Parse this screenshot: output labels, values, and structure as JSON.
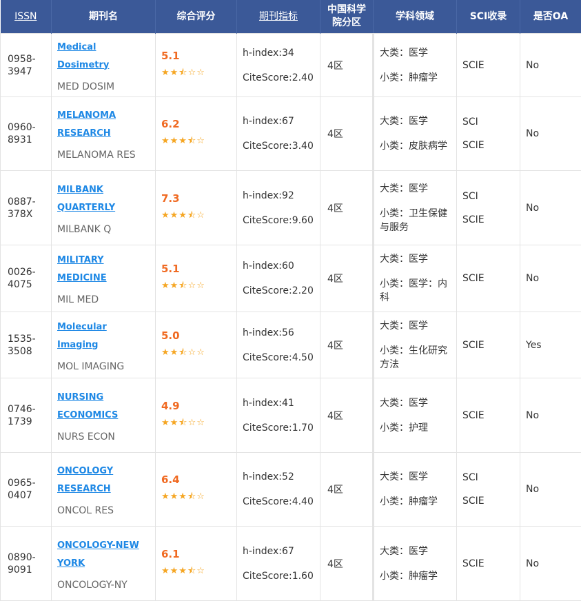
{
  "headers": {
    "issn": "ISSN",
    "name": "期刊名",
    "score": "综合评分",
    "metrics": "期刊指标",
    "zone_line1": "中国科学",
    "zone_line2": "院分区",
    "subject": "学科领域",
    "sci": "SCI收录",
    "oa": "是否OA"
  },
  "rows": [
    {
      "issn1": "0958-",
      "issn2": "3947",
      "name_lines": [
        "Medical Dosimetry",
        ""
      ],
      "abbr": "MED DOSIM",
      "score": "5.1",
      "stars": "★★⯪☆☆",
      "hindex": "h-index:34",
      "citescore": "CiteScore:2.40",
      "zone": "4区",
      "major": "大类：医学",
      "minor": "小类：肿瘤学",
      "sci": [
        "SCIE",
        ""
      ],
      "oa": "No"
    },
    {
      "issn1": "0960-",
      "issn2": "8931",
      "name_lines": [
        "MELANOMA",
        "RESEARCH"
      ],
      "abbr": "MELANOMA RES",
      "score": "6.2",
      "stars": "★★★⯪☆",
      "hindex": "h-index:67",
      "citescore": "CiteScore:3.40",
      "zone": "4区",
      "major": "大类：医学",
      "minor": "小类：皮肤病学",
      "sci": [
        "SCI",
        "SCIE"
      ],
      "oa": "No"
    },
    {
      "issn1": "0887-",
      "issn2": "378X",
      "name_lines": [
        "MILBANK",
        "QUARTERLY"
      ],
      "abbr": "MILBANK Q",
      "score": "7.3",
      "stars": "★★★⯪☆",
      "hindex": "h-index:92",
      "citescore": "CiteScore:9.60",
      "zone": "4区",
      "major": "大类：医学",
      "minor": "小类：卫生保健与服务",
      "sci": [
        "SCI",
        "SCIE"
      ],
      "oa": "No"
    },
    {
      "issn1": "0026-",
      "issn2": "4075",
      "name_lines": [
        "MILITARY MEDICINE",
        ""
      ],
      "abbr": "MIL MED",
      "score": "5.1",
      "stars": "★★⯪☆☆",
      "hindex": "h-index:60",
      "citescore": "CiteScore:2.20",
      "zone": "4区",
      "major": "大类：医学",
      "minor": "小类：医学：内科",
      "sci": [
        "SCIE",
        ""
      ],
      "oa": "No"
    },
    {
      "issn1": "1535-",
      "issn2": "3508",
      "name_lines": [
        "Molecular Imaging",
        ""
      ],
      "abbr": "MOL IMAGING",
      "score": "5.0",
      "stars": "★★⯪☆☆",
      "hindex": "h-index:56",
      "citescore": "CiteScore:4.50",
      "zone": "4区",
      "major": "大类：医学",
      "minor": "小类：生化研究方法",
      "sci": [
        "SCIE",
        ""
      ],
      "oa": "Yes"
    },
    {
      "issn1": "0746-",
      "issn2": "1739",
      "name_lines": [
        "NURSING",
        "ECONOMICS"
      ],
      "abbr": "NURS ECON",
      "score": "4.9",
      "stars": "★★⯪☆☆",
      "hindex": "h-index:41",
      "citescore": "CiteScore:1.70",
      "zone": "4区",
      "major": "大类：医学",
      "minor": "小类：护理",
      "sci": [
        "SCIE",
        ""
      ],
      "oa": "No"
    },
    {
      "issn1": "0965-",
      "issn2": "0407",
      "name_lines": [
        "ONCOLOGY",
        "RESEARCH"
      ],
      "abbr": "ONCOL RES",
      "score": "6.4",
      "stars": "★★★⯪☆",
      "hindex": "h-index:52",
      "citescore": "CiteScore:4.40",
      "zone": "4区",
      "major": "大类：医学",
      "minor": "小类：肿瘤学",
      "sci": [
        "SCI",
        "SCIE"
      ],
      "oa": "No"
    },
    {
      "issn1": "0890-",
      "issn2": "9091",
      "name_lines": [
        "ONCOLOGY-NEW",
        "YORK"
      ],
      "abbr": "ONCOLOGY-NY",
      "score": "6.1",
      "stars": "★★★⯪☆",
      "hindex": "h-index:67",
      "citescore": "CiteScore:1.60",
      "zone": "4区",
      "major": "大类：医学",
      "minor": "小类：肿瘤学",
      "sci": [
        "SCIE",
        ""
      ],
      "oa": "No"
    }
  ]
}
